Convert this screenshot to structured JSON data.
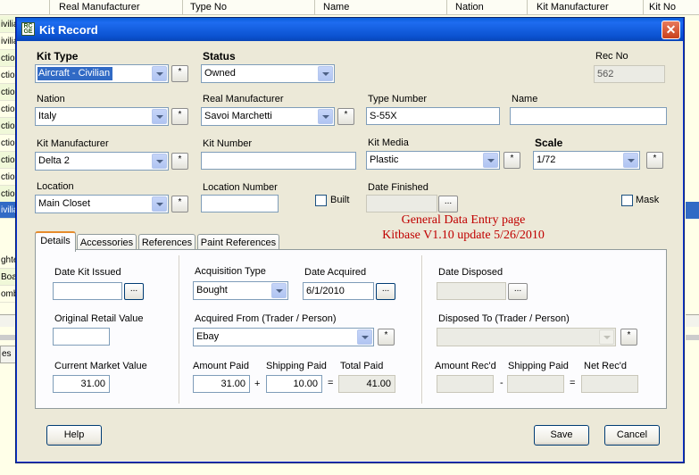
{
  "background": {
    "columns": [
      "Real Manufacturer",
      "Type No",
      "Name",
      "Nation",
      "Kit Manufacturer",
      "Kit No"
    ],
    "row_fragments": [
      "ivilian",
      "ivilian",
      "ction",
      "ction",
      "ction",
      "ction",
      "ction",
      "ction",
      "ction",
      "ction",
      "ction",
      "ction",
      "ivilian",
      "ghte",
      "Boat",
      "ction",
      "ombe"
    ],
    "tab_fragment": "es"
  },
  "window": {
    "title": "Kit Record",
    "icon": "kit-app-icon",
    "close_icon": "close-icon",
    "close_glyph": "✕",
    "accent": "#0a5fd8"
  },
  "form": {
    "kit_type": {
      "label": "Kit Type",
      "value": "Aircraft - Civilian"
    },
    "status": {
      "label": "Status",
      "value": "Owned"
    },
    "rec_no": {
      "label": "Rec No",
      "value": "562"
    },
    "nation": {
      "label": "Nation",
      "value": "Italy"
    },
    "real_manufacturer": {
      "label": "Real Manufacturer",
      "value": "Savoi Marchetti"
    },
    "type_number": {
      "label": "Type Number",
      "value": "S-55X"
    },
    "name": {
      "label": "Name",
      "value": ""
    },
    "kit_manufacturer": {
      "label": "Kit Manufacturer",
      "value": "Delta 2"
    },
    "kit_number": {
      "label": "Kit Number",
      "value": ""
    },
    "kit_media": {
      "label": "Kit Media",
      "value": "Plastic"
    },
    "scale": {
      "label": "Scale",
      "value": "1/72"
    },
    "location": {
      "label": "Location",
      "value": "Main Closet"
    },
    "location_number": {
      "label": "Location Number",
      "value": ""
    },
    "built": {
      "label": "Built",
      "checked": false
    },
    "date_finished": {
      "label": "Date Finished",
      "value": ""
    },
    "mask": {
      "label": "Mask",
      "checked": false
    },
    "add_glyph": "*",
    "ellipsis_glyph": "..."
  },
  "note": {
    "line1": "General Data Entry page",
    "line2": "Kitbase V1.10 update 5/26/2010",
    "color": "#c00000"
  },
  "tabs": [
    {
      "label": "Details",
      "active": true
    },
    {
      "label": "Accessories",
      "active": false
    },
    {
      "label": "References",
      "active": false
    },
    {
      "label": "Paint References",
      "active": false
    }
  ],
  "details": {
    "date_kit_issued": {
      "label": "Date Kit Issued",
      "value": ""
    },
    "original_retail_value": {
      "label": "Original Retail Value",
      "value": ""
    },
    "current_market_value": {
      "label": "Current Market Value",
      "value": "31.00"
    },
    "acquisition_type": {
      "label": "Acquisition Type",
      "value": "Bought"
    },
    "date_acquired": {
      "label": "Date Acquired",
      "value": "6/1/2010"
    },
    "acquired_from": {
      "label": "Acquired From (Trader / Person)",
      "value": "Ebay"
    },
    "amount_paid": {
      "label": "Amount Paid",
      "value": "31.00"
    },
    "shipping_paid": {
      "label": "Shipping Paid",
      "value": "10.00"
    },
    "total_paid": {
      "label": "Total Paid",
      "value": "41.00"
    },
    "plus": "+",
    "equals": "=",
    "minus": "-",
    "date_disposed": {
      "label": "Date Disposed",
      "value": ""
    },
    "disposed_to": {
      "label": "Disposed To (Trader / Person)",
      "value": ""
    },
    "amount_recd": {
      "label": "Amount Rec'd",
      "value": ""
    },
    "shipping_paid_disposal": {
      "label": "Shipping Paid",
      "value": ""
    },
    "net_recd": {
      "label": "Net Rec'd",
      "value": ""
    }
  },
  "buttons": {
    "help": "Help",
    "save": "Save",
    "cancel": "Cancel"
  }
}
